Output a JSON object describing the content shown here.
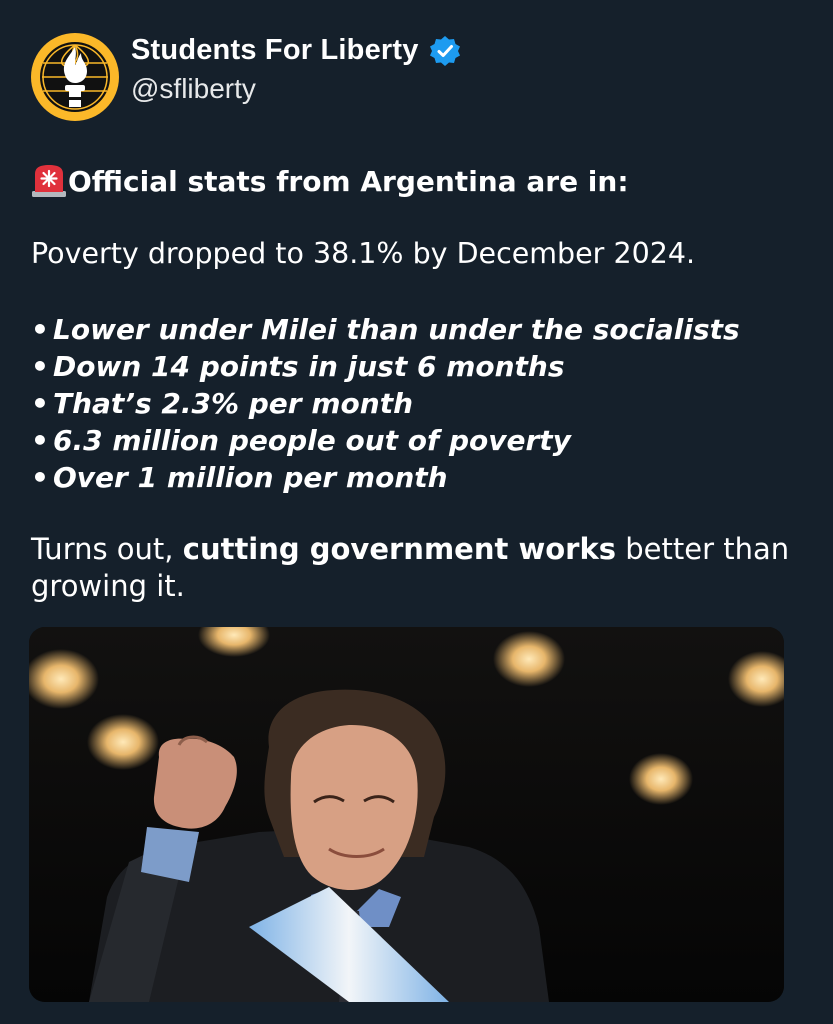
{
  "author": {
    "display_name": "Students For Liberty",
    "handle": "@sfliberty",
    "verified_icon": "verified-badge-icon",
    "avatar_icon": "torch-logo-icon",
    "brand_color": "#fbb829",
    "verified_color": "#1d9bf0"
  },
  "tweet": {
    "headline_emoji": "rotating-light-icon",
    "headline": "Official stats from Argentina are in:",
    "lead": "Poverty dropped to 38.1% by December 2024.",
    "bullets": [
      "Lower under Milei than under the socialists",
      "Down 14 points in just 6 months",
      "That’s 2.3% per month",
      "6.3 million people out of poverty",
      "Over 1 million per month"
    ],
    "closing_prefix": "Turns out, ",
    "closing_bold": "cutting government works",
    "closing_suffix": " better than growing it."
  },
  "media": {
    "type": "photo",
    "subject": "man-with-raised-fist-and-presidential-sash"
  },
  "colors": {
    "background": "#15202b",
    "text": "#ffffff"
  }
}
